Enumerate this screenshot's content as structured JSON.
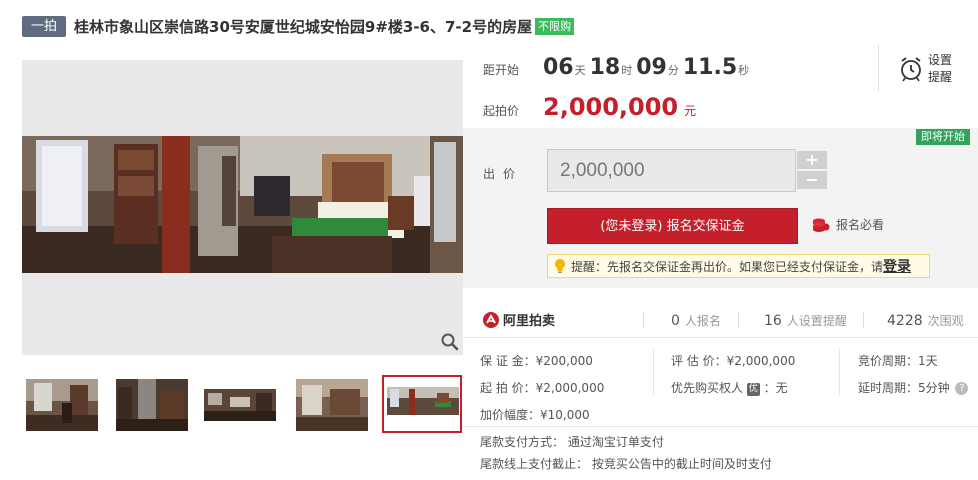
{
  "title": {
    "tag": "一拍",
    "text": "桂林市象山区崇信路30号安厦世纪城安怡园9#楼3-6、7-2号的房屋",
    "badge": "不限购"
  },
  "countdown": {
    "label": "距开始",
    "days": "06",
    "days_unit": "天",
    "hours": "18",
    "hours_unit": "时",
    "minutes": "09",
    "minutes_unit": "分",
    "seconds": "11.5",
    "seconds_unit": "秒"
  },
  "price": {
    "label": "起拍价",
    "value": "2,000,000",
    "unit": "元"
  },
  "remind": {
    "line1": "设置",
    "line2": "提醒",
    "icon": "alarm-clock-icon"
  },
  "bid": {
    "status_badge": "即将开始",
    "label": "出价",
    "input_value": "2,000,000",
    "plus": "+",
    "minus": "−",
    "register_button": "(您未登录) 报名交保证金",
    "must_read": "报名必看",
    "tip_text": "提醒：先报名交保证金再出价。如果您已经支付保证金，请",
    "tip_link": "登录"
  },
  "stats": {
    "platform": "阿里拍卖",
    "signups_num": "0",
    "signups_label": "人报名",
    "reminders_num": "16",
    "reminders_label": "人设置提醒",
    "views_num": "4228",
    "views_label": "次围观"
  },
  "details": {
    "deposit": "保 证 金：¥200,000",
    "start_price": "起 拍 价：¥2,000,000",
    "increment": "加价幅度：¥10,000",
    "appraisal": "评 估 价：¥2,000,000",
    "priority": "优先购买权人",
    "priority_badge": "优",
    "priority_value": "：无",
    "cycle": "竞价周期：1天",
    "delay": "延时周期：5分钟",
    "payment_method": "尾款支付方式： 通过淘宝订单支付",
    "payment_deadline": "尾款线上支付截止： 按竞买公告中的截止时间及时支付"
  },
  "colors": {
    "accent": "#c41f2b",
    "green": "#3cbb5a",
    "tag": "#5e6b80"
  }
}
